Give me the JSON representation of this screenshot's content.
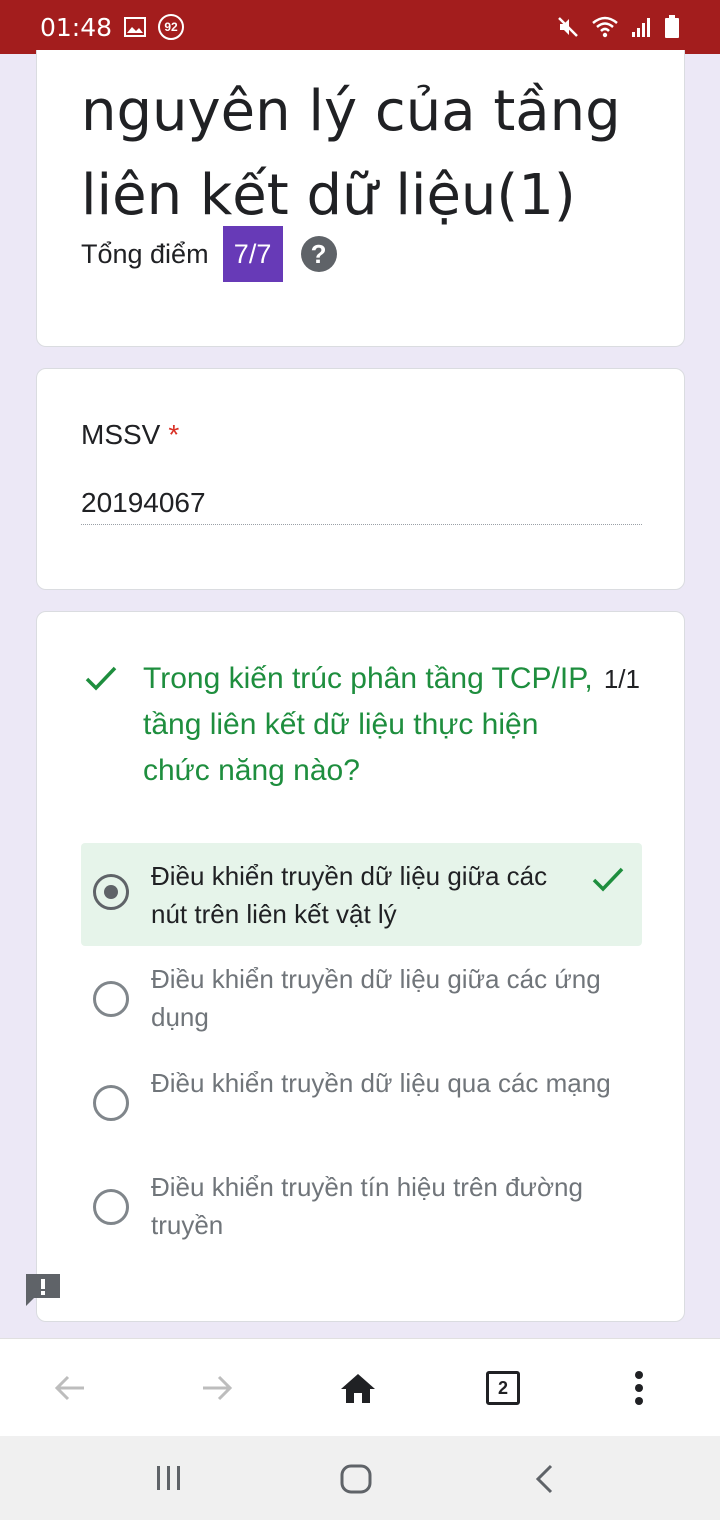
{
  "status_bar": {
    "time": "01:48",
    "notification_count": "92",
    "icons": [
      "gallery-icon",
      "notification-badge-icon",
      "mute-icon",
      "wifi-icon",
      "signal-icon",
      "battery-icon"
    ]
  },
  "form": {
    "title": "nguyên lý của tầng liên kết dữ liệu(1)",
    "score_label": "Tổng điểm",
    "score_value": "7/7",
    "help_icon_text": "?"
  },
  "mssv": {
    "label": "MSSV",
    "required_mark": "*",
    "value": "20194067"
  },
  "question": {
    "text": "Trong kiến trúc phân tầng TCP/IP, tầng liên kết dữ liệu thực hiện chức năng nào?",
    "score": "1/1",
    "options": [
      {
        "label": "Điều khiển truyền dữ liệu giữa các nút trên liên kết vật lý",
        "selected": true,
        "correct": true
      },
      {
        "label": "Điều khiển truyền dữ liệu giữa các ứng dụng",
        "selected": false
      },
      {
        "label": "Điều khiển truyền dữ liệu qua các mạng",
        "selected": false
      },
      {
        "label": "Điều khiển truyền tín hiệu trên đường truyền",
        "selected": false
      }
    ]
  },
  "browser_bar": {
    "tab_count": "2",
    "items": [
      "back-arrow-icon",
      "forward-arrow-icon",
      "home-icon",
      "tabs-icon",
      "more-menu-icon"
    ]
  },
  "colors": {
    "status_bar": "#a31d1d",
    "background": "#ece8f6",
    "accent_purple": "#673ab7",
    "correct_green": "#1e8e3e",
    "selected_bg": "#e6f4ea"
  }
}
